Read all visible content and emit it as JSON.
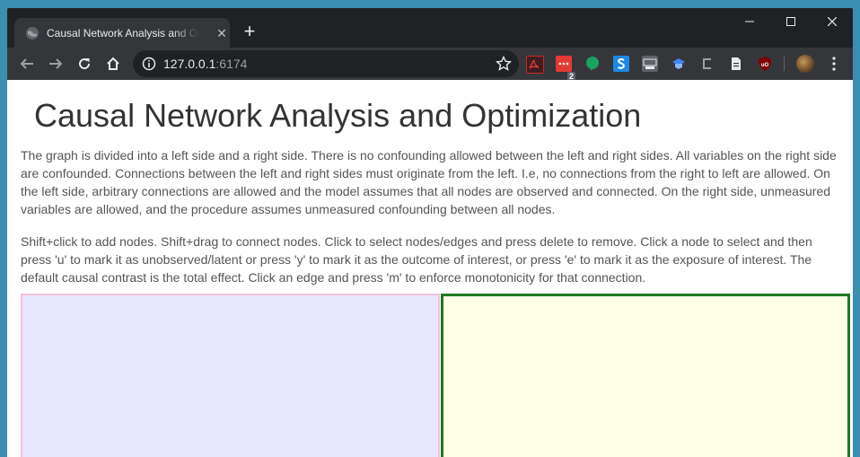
{
  "browser": {
    "tab_title": "Causal Network Analysis and Optimization",
    "tab_close_glyph": "✕",
    "new_tab_glyph": "+",
    "url_host": "127.0.0.1",
    "url_port": ":6174",
    "extension_badge": "2",
    "icons": [
      "back-icon",
      "forward-icon",
      "reload-icon",
      "home-icon",
      "info-icon",
      "star-icon",
      "pdf-extension-icon",
      "calendar-extension-icon",
      "evernote-extension-icon",
      "s-extension-icon",
      "css-extension-icon",
      "blue-extension-icon",
      "clip-extension-icon",
      "doc-extension-icon",
      "ublock-extension-icon",
      "avatar",
      "menu-icon"
    ],
    "colors": {
      "frame": "#202124",
      "toolbar": "#35363a",
      "desktop": "#3a8fb0"
    }
  },
  "page": {
    "title": "Causal Network Analysis and Optimization",
    "paragraph1": "The graph is divided into a left side and a right side. There is no confounding allowed between the left and right sides. All variables on the right side are confounded. Connections between the left and right sides must originate from the left. I.e, no connections from the right to left are allowed. On the left side, arbitrary connections are allowed and the model assumes that all nodes are observed and connected. On the right side, unmeasured variables are allowed, and the procedure assumes unmeasured confounding between all nodes.",
    "paragraph2": "Shift+click to add nodes. Shift+drag to connect nodes. Click to select nodes/edges and press delete to remove. Click a node to select and then press 'u' to mark it as unobserved/latent or press 'y' to mark it as the outcome of interest, or press 'e' to mark it as the exposure of interest. The default causal contrast is the total effect. Click an edge and press 'm' to enforce monotonicity for that connection.",
    "colors": {
      "left_pane": "#e6e6ff",
      "left_border": "#f4c2d7",
      "right_pane": "#ffffe6",
      "right_border": "#1f7a1f"
    }
  }
}
